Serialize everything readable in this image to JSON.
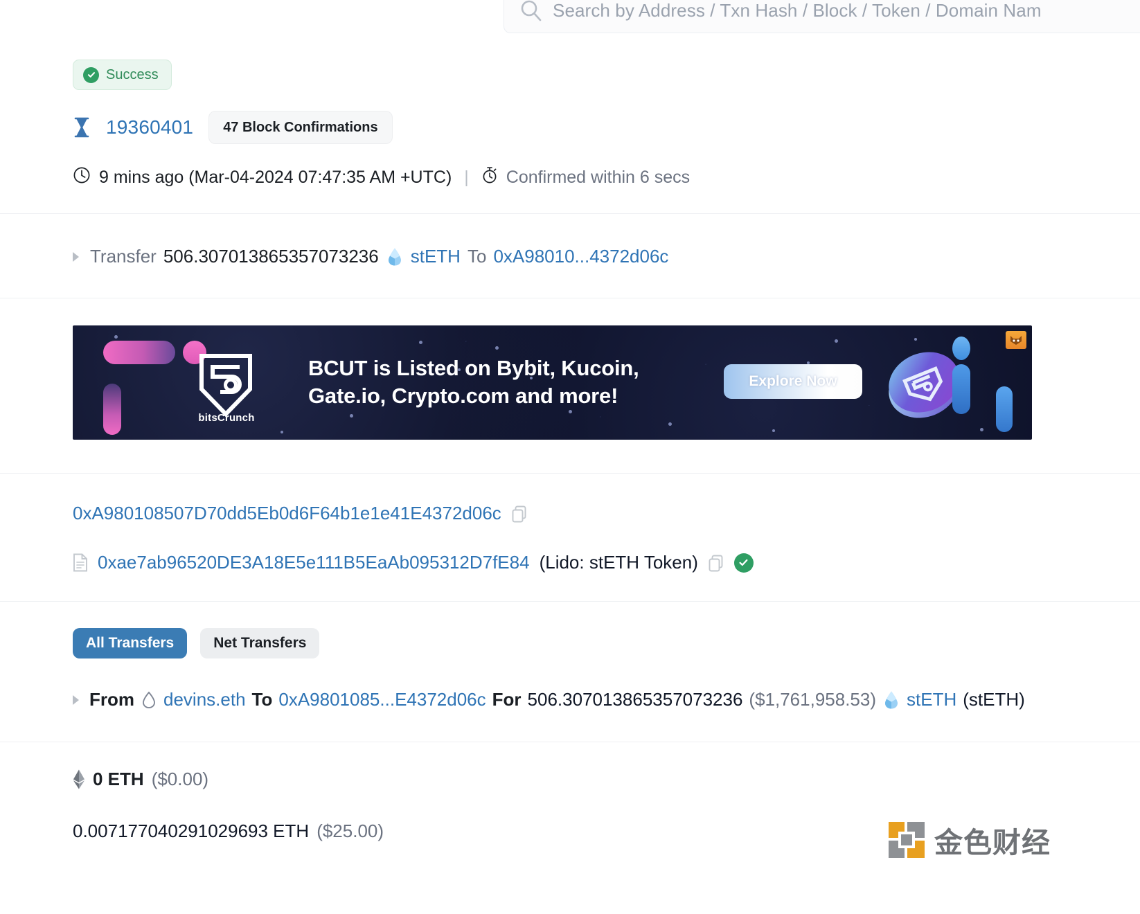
{
  "search": {
    "placeholder": "Search by Address / Txn Hash / Block / Token / Domain Nam",
    "icon": "search-icon"
  },
  "status": {
    "label": "Success",
    "icon": "check-circle-icon",
    "color": "#2f9e63"
  },
  "block": {
    "icon": "hourglass-icon",
    "number": "19360401",
    "confirmations": "47 Block Confirmations"
  },
  "timestamp": {
    "clock_icon": "clock-icon",
    "relative": "9 mins ago (Mar-04-2024 07:47:35 AM +UTC)",
    "separator": "|",
    "stopwatch_icon": "stopwatch-icon",
    "confirmed_within": "Confirmed within 6 secs"
  },
  "transfer": {
    "caret": "caret-right-icon",
    "label": "Transfer",
    "amount": "506.307013865357073236",
    "token_icon": "steth-token-icon",
    "token": "stETH",
    "to_label": "To",
    "to_address": "0xA98010...4372d06c"
  },
  "banner": {
    "brand": "bitsCrunch",
    "headline_line1": "BCUT is Listed on Bybit, Kucoin,",
    "headline_line2": "Gate.io, Crypto.com and more!",
    "cta": "Explore Now",
    "ad_badge_icon": "ad-fox-icon"
  },
  "addresses": {
    "interacted": {
      "value": "0xA980108507D70dd5Eb0d6F64b1e1e41E4372d06c",
      "copy_icon": "copy-icon"
    },
    "token_contract": {
      "doc_icon": "document-icon",
      "value": "0xae7ab96520DE3A18E5e111B5EaAb095312D7fE84",
      "name": "(Lido: stETH Token)",
      "copy_icon": "copy-icon",
      "verified_icon": "verified-check-icon"
    }
  },
  "tabs": [
    {
      "label": "All Transfers",
      "active": true
    },
    {
      "label": "Net Transfers",
      "active": false
    }
  ],
  "token_transfer": {
    "caret": "caret-right-icon",
    "from_label": "From",
    "from_icon": "ens-diamond-icon",
    "from_value": "devins.eth",
    "to_label": "To",
    "to_value": "0xA9801085...E4372d06c",
    "for_label": "For",
    "amount": "506.307013865357073236",
    "usd": "($1,761,958.53)",
    "token_icon": "steth-token-icon",
    "token": "stETH",
    "token_symbol": "(stETH)"
  },
  "values": {
    "eth_icon": "ethereum-icon",
    "value_amount": "0 ETH",
    "value_usd": "($0.00)",
    "fee_amount": "0.007177040291029693 ETH",
    "fee_usd": "($25.00)"
  },
  "watermark": {
    "text": "金色财经"
  }
}
